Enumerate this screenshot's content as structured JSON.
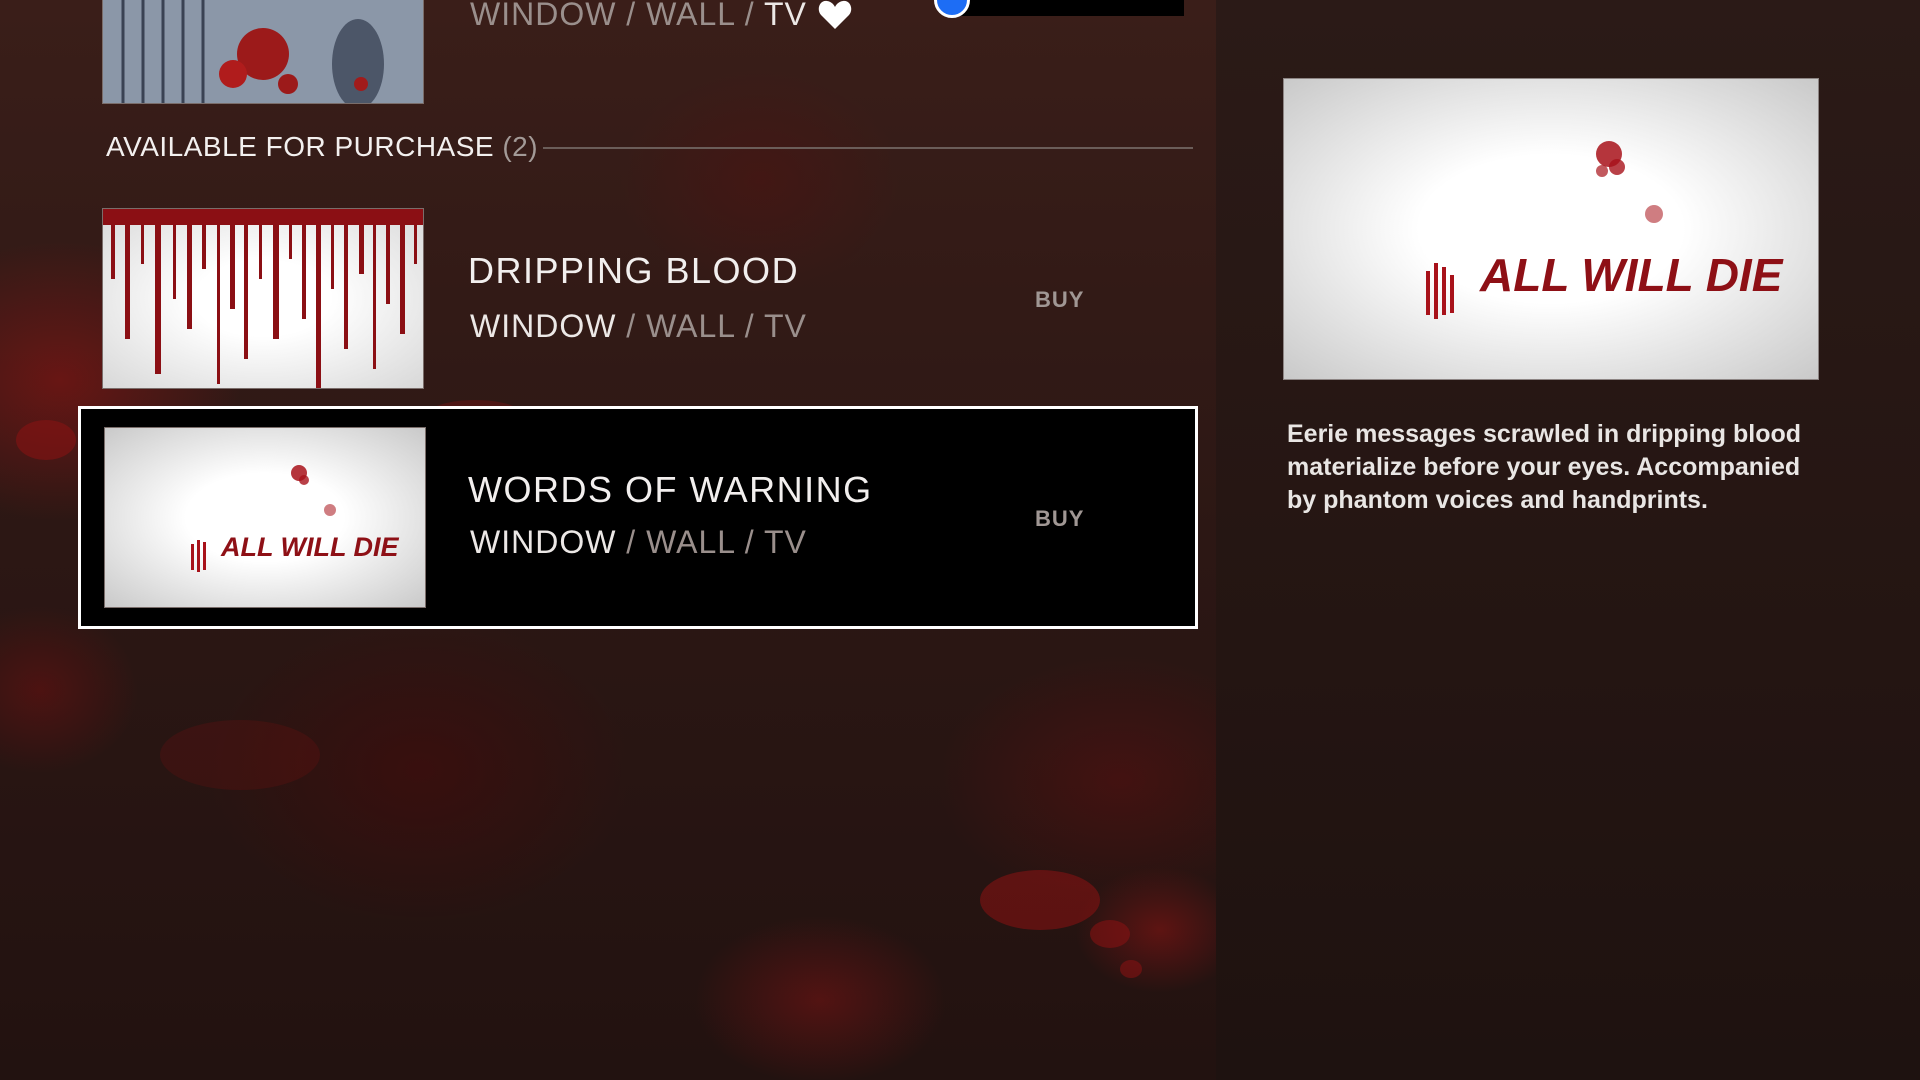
{
  "colors": {
    "accent_blue": "#1d6df5",
    "blood_red": "#8b0f14",
    "selected_border": "#ffffff",
    "text_primary": "#f2efee",
    "text_muted": "#9a8f8c"
  },
  "top_item": {
    "platforms": {
      "window": "WINDOW",
      "sep1": " / ",
      "wall": "WALL",
      "sep2": " / ",
      "tv": "TV"
    },
    "favorite_icon": "heart-icon"
  },
  "section": {
    "title": "AVAILABLE FOR PURCHASE",
    "count": "(2)"
  },
  "items": [
    {
      "title": "DRIPPING BLOOD",
      "platforms": {
        "window": "WINDOW",
        "sep1": " / ",
        "wall": "WALL",
        "sep2": " / ",
        "tv": "TV"
      },
      "action": "BUY"
    },
    {
      "title": "WORDS OF WARNING",
      "platforms": {
        "window": "WINDOW",
        "sep1": " / ",
        "wall": "WALL",
        "sep2": " / ",
        "tv": "TV"
      },
      "action": "BUY",
      "thumb_text": "ALL WILL DIE"
    }
  ],
  "detail": {
    "image_text": "ALL WILL DIE",
    "description": "Eerie messages scrawled in dripping blood materialize before your eyes. Accompanied by phantom voices and handprints."
  }
}
